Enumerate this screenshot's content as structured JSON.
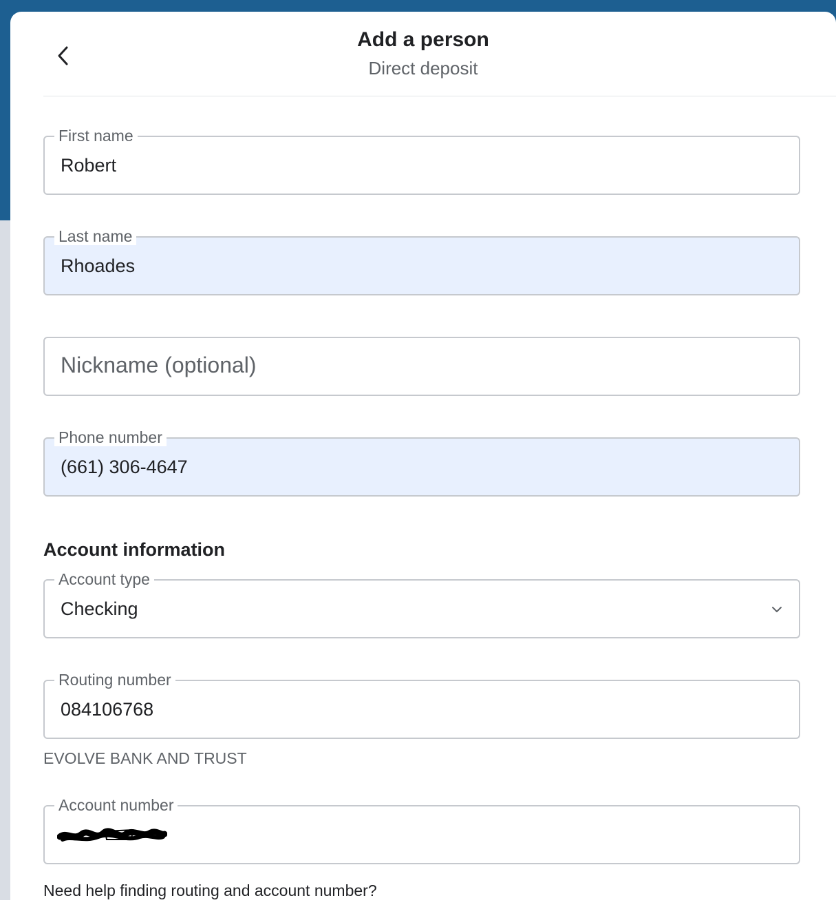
{
  "header": {
    "title": "Add a person",
    "subtitle": "Direct deposit",
    "back_icon": "chevron-left-icon"
  },
  "form": {
    "first_name": {
      "label": "First name",
      "value": "Robert"
    },
    "last_name": {
      "label": "Last name",
      "value": "Rhoades"
    },
    "nickname": {
      "placeholder": "Nickname (optional)",
      "value": ""
    },
    "phone": {
      "label": "Phone number",
      "value": "(661) 306-4647"
    }
  },
  "account": {
    "section_title": "Account information",
    "account_type": {
      "label": "Account type",
      "value": "Checking",
      "icon": "chevron-down-icon"
    },
    "routing_number": {
      "label": "Routing number",
      "value": "084106768"
    },
    "bank_name": "EVOLVE BANK AND TRUST",
    "account_number": {
      "label": "Account number",
      "redacted": true
    },
    "help_link": "Need help finding routing and account number?"
  },
  "colors": {
    "header_band": "#1d5f91",
    "autofill_bg": "#e8f0fe",
    "border": "#c6c9ce"
  }
}
